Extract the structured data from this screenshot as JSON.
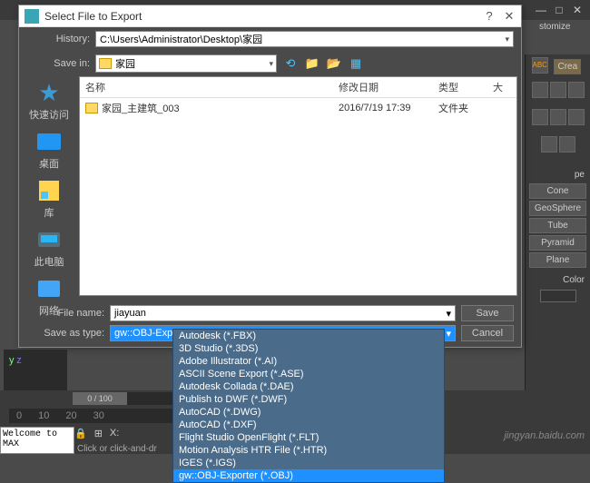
{
  "back_titlebar": {
    "min": "—",
    "max": "□",
    "close": "✕"
  },
  "main_menu": {
    "customize": "stomize"
  },
  "right_panel": {
    "create_label": "Crea",
    "shape_label": "pe",
    "buttons": [
      "Cone",
      "GeoSphere",
      "Tube",
      "Pyramid",
      "Plane"
    ],
    "color_label": "Color"
  },
  "dialog": {
    "title": "Select File to Export",
    "close": "✕",
    "help": "?",
    "history_label": "History:",
    "history_value": "C:\\Users\\Administrator\\Desktop\\家园",
    "savein_label": "Save in:",
    "savein_value": "家园",
    "columns": {
      "name": "名称",
      "date": "修改日期",
      "type": "类型",
      "x": "大"
    },
    "files": [
      {
        "name": "家园_主建筑_003",
        "date": "2016/7/19 17:39",
        "type": "文件夹"
      }
    ],
    "sidebar": [
      {
        "id": "quick",
        "label": "快速访问"
      },
      {
        "id": "desktop",
        "label": "桌面"
      },
      {
        "id": "library",
        "label": "库"
      },
      {
        "id": "thispc",
        "label": "此电脑"
      },
      {
        "id": "network",
        "label": "网络"
      }
    ],
    "filename_label": "File name:",
    "filename_value": "jiayuan",
    "saveas_label": "Save as type:",
    "saveas_value": "gw::OBJ-Exporter (*.OBJ)",
    "save_btn": "Save",
    "cancel_btn": "Cancel",
    "type_options": [
      "Autodesk (*.FBX)",
      "3D Studio (*.3DS)",
      "Adobe Illustrator (*.AI)",
      "ASCII Scene Export (*.ASE)",
      "Autodesk Collada (*.DAE)",
      "Publish to DWF (*.DWF)",
      "AutoCAD (*.DWG)",
      "AutoCAD (*.DXF)",
      "Flight Studio OpenFlight (*.FLT)",
      "Motion Analysis HTR File (*.HTR)",
      "IGES (*.IGS)",
      "gw::OBJ-Exporter (*.OBJ)"
    ],
    "selected_option_idx": 11
  },
  "timeline": {
    "frame": "0 / 100",
    "ticks": [
      "0",
      "10",
      "20",
      "30"
    ],
    "status_x": "X:",
    "welcome": "Welcome to MAX",
    "hint": "Click or click-and-dr"
  },
  "watermark": "jingyan.baidu.com"
}
